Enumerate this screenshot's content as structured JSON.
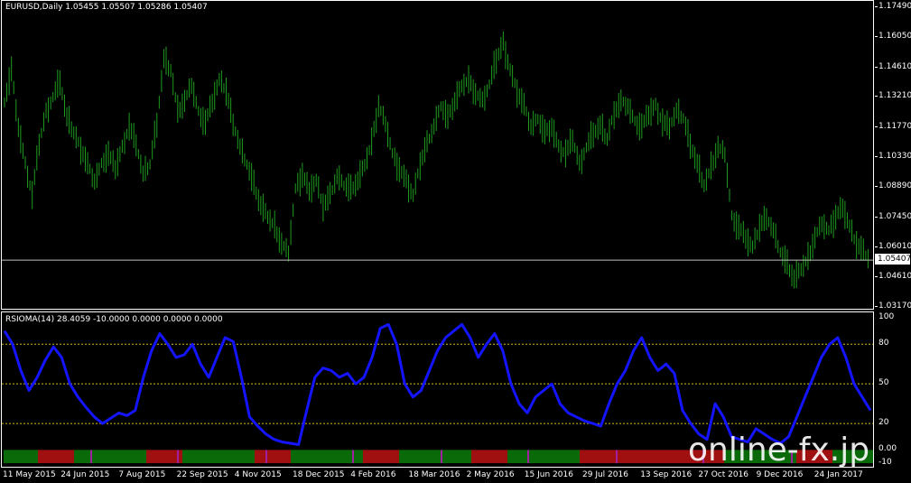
{
  "main_header": "EURUSD,Daily  1.05455 1.05507 1.05286 1.05407",
  "sub_header": "RSIOMA(14) 28.4059 -10.0000 0.0000 0.0000 0.0000",
  "current_price": "1.05407",
  "price_ticks": [
    "1.17490",
    "1.16050",
    "1.14610",
    "1.13210",
    "1.11770",
    "1.10330",
    "1.08890",
    "1.07450",
    "1.06010",
    "1.04610",
    "1.03170"
  ],
  "rsi_ticks": [
    "100",
    "80",
    "50",
    "20",
    "0.00",
    "-10"
  ],
  "dates": [
    "11 May 2015",
    "24 Jun 2015",
    "7 Aug 2015",
    "22 Sep 2015",
    "4 Nov 2015",
    "18 Dec 2015",
    "4 Feb 2016",
    "18 Mar 2016",
    "2 May 2016",
    "15 Jun 2016",
    "29 Jul 2016",
    "13 Sep 2016",
    "27 Oct 2016",
    "9 Dec 2016",
    "24 Jan 2017"
  ],
  "watermark": "online-fx.jp",
  "colors": {
    "candles": "#1e9c1e",
    "rsi_line": "#1414ff",
    "levels": "#d4c21a",
    "bar_up": "#0a6a0a",
    "bar_down": "#a01010",
    "bar_mid": "#a020a0"
  },
  "chart_data": {
    "type": "line",
    "series": [
      {
        "name": "",
        "values": [
          1.13,
          1.145,
          1.118,
          1.1,
          1.085,
          1.11,
          1.125,
          1.132,
          1.14,
          1.122,
          1.115,
          1.108,
          1.1,
          1.092,
          1.1,
          1.105,
          1.098,
          1.108,
          1.118,
          1.11,
          1.095,
          1.1,
          1.12,
          1.15,
          1.145,
          1.125,
          1.13,
          1.138,
          1.125,
          1.12,
          1.13,
          1.14,
          1.135,
          1.12,
          1.108,
          1.1,
          1.09,
          1.08,
          1.075,
          1.07,
          1.062,
          1.058,
          1.088,
          1.095,
          1.088,
          1.092,
          1.08,
          1.085,
          1.094,
          1.09,
          1.088,
          1.092,
          1.1,
          1.11,
          1.128,
          1.12,
          1.105,
          1.098,
          1.092,
          1.085,
          1.1,
          1.11,
          1.118,
          1.128,
          1.122,
          1.13,
          1.138,
          1.14,
          1.134,
          1.13,
          1.138,
          1.15,
          1.158,
          1.145,
          1.135,
          1.128,
          1.118,
          1.122,
          1.115,
          1.118,
          1.108,
          1.105,
          1.112,
          1.1,
          1.108,
          1.115,
          1.118,
          1.112,
          1.125,
          1.13,
          1.128,
          1.12,
          1.118,
          1.124,
          1.128,
          1.12,
          1.118,
          1.125,
          1.122,
          1.11,
          1.1,
          1.09,
          1.098,
          1.108,
          1.105,
          1.075,
          1.07,
          1.065,
          1.06,
          1.07,
          1.075,
          1.068,
          1.058,
          1.052,
          1.045,
          1.05,
          1.055,
          1.065,
          1.072,
          1.068,
          1.075,
          1.08,
          1.07,
          1.062,
          1.058,
          1.054
        ]
      },
      {
        "name": "RSIOMA(14)",
        "values": [
          90,
          80,
          60,
          45,
          55,
          68,
          78,
          70,
          50,
          40,
          32,
          25,
          20,
          24,
          28,
          26,
          30,
          55,
          75,
          88,
          80,
          70,
          72,
          80,
          65,
          55,
          70,
          85,
          82,
          55,
          25,
          18,
          12,
          8,
          6,
          5,
          4,
          30,
          55,
          62,
          60,
          55,
          58,
          50,
          55,
          70,
          92,
          95,
          80,
          50,
          40,
          45,
          60,
          75,
          85,
          90,
          95,
          85,
          70,
          80,
          88,
          75,
          50,
          35,
          28,
          40,
          45,
          50,
          35,
          28,
          25,
          22,
          20,
          18,
          35,
          50,
          60,
          75,
          85,
          70,
          60,
          65,
          58,
          30,
          20,
          12,
          8,
          35,
          25,
          10,
          8,
          6,
          16,
          12,
          8,
          5,
          10,
          25,
          40,
          55,
          70,
          80,
          85,
          70,
          50,
          40,
          30
        ]
      }
    ],
    "ylim_price": [
      1.0317,
      1.1749
    ],
    "ylim_rsi": [
      -10,
      100
    ],
    "levels": [
      80,
      50,
      20
    ]
  }
}
